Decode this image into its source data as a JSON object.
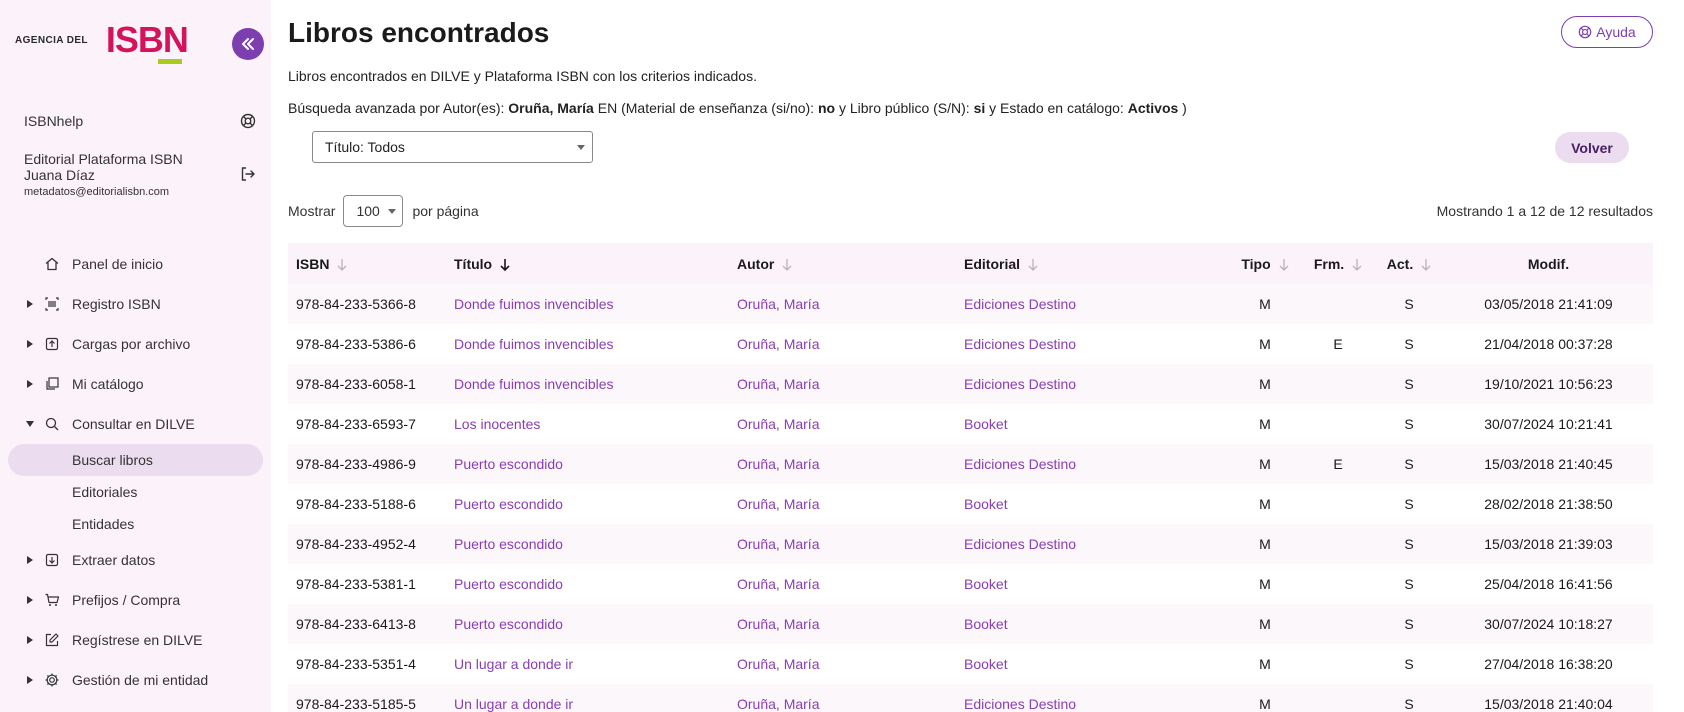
{
  "logo": {
    "prefix": "AGENCIA DEL",
    "name": "ISBN"
  },
  "sidebar": {
    "help_label": "ISBNhelp",
    "user": {
      "org": "Editorial Plataforma ISBN",
      "name": "Juana Díaz",
      "email": "metadatos@editorialisbn.com"
    },
    "nav": [
      {
        "label": "Panel de inicio",
        "icon": "home-icon"
      },
      {
        "label": "Registro ISBN",
        "icon": "barcode-icon"
      },
      {
        "label": "Cargas por archivo",
        "icon": "upload-icon"
      },
      {
        "label": "Mi catálogo",
        "icon": "catalog-icon"
      },
      {
        "label": "Consultar en DILVE",
        "icon": "search-icon"
      },
      {
        "label": "Extraer datos",
        "icon": "download-icon"
      },
      {
        "label": "Prefijos / Compra",
        "icon": "cart-icon"
      },
      {
        "label": "Regístrese en DILVE",
        "icon": "edit-icon"
      },
      {
        "label": "Gestión de mi entidad",
        "icon": "gear-icon"
      }
    ],
    "subnav": [
      {
        "label": "Buscar libros"
      },
      {
        "label": "Editoriales"
      },
      {
        "label": "Entidades"
      }
    ]
  },
  "main": {
    "title": "Libros encontrados",
    "help_button": "Ayuda",
    "subtitle": "Libros encontrados en DILVE y Plataforma ISBN con los criterios indicados.",
    "criteria": {
      "p1": "Búsqueda avanzada por Autor(es): ",
      "author": "Oruña, María",
      "p2": " EN (Material de enseñanza (si/no): ",
      "teaching": "no",
      "p3": " y Libro público (S/N): ",
      "public": "si",
      "p4": " y Estado en catálogo: ",
      "status": "Activos",
      "p5": " )"
    },
    "title_filter": "Título: Todos",
    "back_button": "Volver",
    "show_label": "Mostrar",
    "per_page_value": "100",
    "per_page_label": "por página",
    "results_text": "Mostrando 1 a 12 de 12 resultados"
  },
  "table": {
    "headers": {
      "isbn": "ISBN",
      "titulo": "Título",
      "autor": "Autor",
      "editorial": "Editorial",
      "tipo": "Tipo",
      "frm": "Frm.",
      "act": "Act.",
      "modif": "Modif."
    },
    "rows": [
      {
        "isbn": "978-84-233-5366-8",
        "titulo": "Donde fuimos invencibles",
        "autor": "Oruña, María",
        "editorial": "Ediciones Destino",
        "tipo": "M",
        "frm": "",
        "act": "S",
        "modif": "03/05/2018 21:41:09"
      },
      {
        "isbn": "978-84-233-5386-6",
        "titulo": "Donde fuimos invencibles",
        "autor": "Oruña, María",
        "editorial": "Ediciones Destino",
        "tipo": "M",
        "frm": "E",
        "act": "S",
        "modif": "21/04/2018 00:37:28"
      },
      {
        "isbn": "978-84-233-6058-1",
        "titulo": "Donde fuimos invencibles",
        "autor": "Oruña, María",
        "editorial": "Ediciones Destino",
        "tipo": "M",
        "frm": "",
        "act": "S",
        "modif": "19/10/2021 10:56:23"
      },
      {
        "isbn": "978-84-233-6593-7",
        "titulo": "Los inocentes",
        "autor": "Oruña, María",
        "editorial": "Booket",
        "tipo": "M",
        "frm": "",
        "act": "S",
        "modif": "30/07/2024 10:21:41"
      },
      {
        "isbn": "978-84-233-4986-9",
        "titulo": "Puerto escondido",
        "autor": "Oruña, María",
        "editorial": "Ediciones Destino",
        "tipo": "M",
        "frm": "E",
        "act": "S",
        "modif": "15/03/2018 21:40:45"
      },
      {
        "isbn": "978-84-233-5188-6",
        "titulo": "Puerto escondido",
        "autor": "Oruña, María",
        "editorial": "Booket",
        "tipo": "M",
        "frm": "",
        "act": "S",
        "modif": "28/02/2018 21:38:50"
      },
      {
        "isbn": "978-84-233-4952-4",
        "titulo": "Puerto escondido",
        "autor": "Oruña, María",
        "editorial": "Ediciones Destino",
        "tipo": "M",
        "frm": "",
        "act": "S",
        "modif": "15/03/2018 21:39:03"
      },
      {
        "isbn": "978-84-233-5381-1",
        "titulo": "Puerto escondido",
        "autor": "Oruña, María",
        "editorial": "Booket",
        "tipo": "M",
        "frm": "",
        "act": "S",
        "modif": "25/04/2018 16:41:56"
      },
      {
        "isbn": "978-84-233-6413-8",
        "titulo": "Puerto escondido",
        "autor": "Oruña, María",
        "editorial": "Booket",
        "tipo": "M",
        "frm": "",
        "act": "S",
        "modif": "30/07/2024 10:18:27"
      },
      {
        "isbn": "978-84-233-5351-4",
        "titulo": "Un lugar a donde ir",
        "autor": "Oruña, María",
        "editorial": "Booket",
        "tipo": "M",
        "frm": "",
        "act": "S",
        "modif": "27/04/2018 16:38:20"
      },
      {
        "isbn": "978-84-233-5185-5",
        "titulo": "Un lugar a donde ir",
        "autor": "Oruña, María",
        "editorial": "Ediciones Destino",
        "tipo": "M",
        "frm": "",
        "act": "S",
        "modif": "15/03/2018 21:40:04"
      }
    ]
  },
  "colors": {
    "accent": "#7d3fb0",
    "brand": "#d4145a",
    "brand_underline": "#a7cb1f",
    "link": "#8a3db5",
    "sidebar_bg": "#fcf3fa"
  }
}
